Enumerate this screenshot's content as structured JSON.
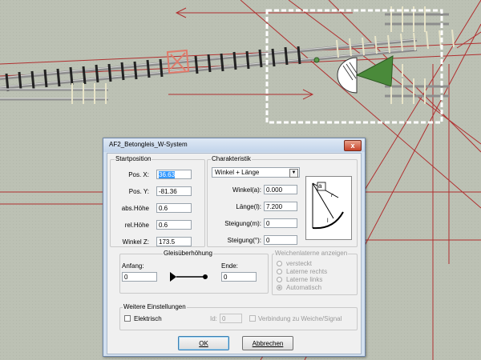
{
  "dialog": {
    "title": "AF2_Betongleis_W-System",
    "close_glyph": "x"
  },
  "startposition": {
    "title": "Startposition",
    "pos_x_label": "Pos. X:",
    "pos_x_value": "36.63",
    "pos_y_label": "Pos. Y:",
    "pos_y_value": "-81.36",
    "abs_hoehe_label": "abs.Höhe",
    "abs_hoehe_value": "0.6",
    "rel_hoehe_label": "rel.Höhe",
    "rel_hoehe_value": "0.6",
    "winkel_z_label": "Winkel Z:",
    "winkel_z_value": "173.5"
  },
  "charakteristik": {
    "title": "Charakteristik",
    "mode_value": "Winkel + Länge",
    "winkel_label": "Winkel(a):",
    "winkel_value": "0.000",
    "laenge_label": "Länge(l):",
    "laenge_value": "7.200",
    "steigung_m_label": "Steigung(m):",
    "steigung_m_value": "0",
    "steigung_deg_label": "Steigung(°):",
    "steigung_deg_value": "0",
    "diagram_a": "a",
    "diagram_r": "r",
    "diagram_l": "l"
  },
  "gleisueberhoehung": {
    "title": "Gleisüberhöhung",
    "anfang_label": "Anfang:",
    "anfang_value": "0",
    "ende_label": "Ende:",
    "ende_value": "0"
  },
  "weichenlaterne": {
    "title": "Weichenlaterne anzeigen",
    "options": [
      "versteckt",
      "Laterne rechts",
      "Laterne links",
      "Automatisch"
    ],
    "selected": "Automatisch"
  },
  "weitere": {
    "title": "Weitere Einstellungen",
    "elektrisch_label": "Elektrisch",
    "id_label": "Id:",
    "id_value": "0",
    "verbindung_label": "Verbindung zu Weiche/Signal"
  },
  "buttons": {
    "ok_label": "OK",
    "cancel_label": "Abbrechen"
  },
  "colors": {
    "accent": "#3399ff",
    "selection_frame": "#ffffff",
    "signal_green": "#4a8a3a",
    "guide_lines": "#b03030"
  }
}
